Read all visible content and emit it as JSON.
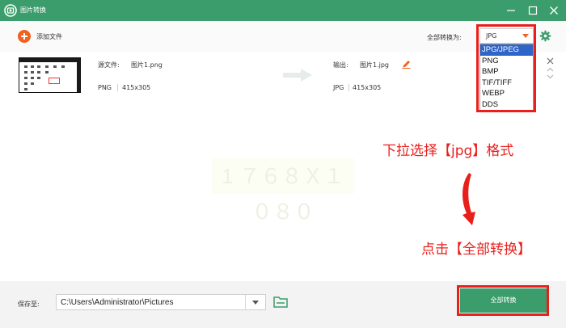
{
  "window": {
    "title": "图片转换"
  },
  "toolbar": {
    "add_label": "添加文件",
    "convert_to_label": "全部转换为:",
    "selected_format": "JPG"
  },
  "dropdown": {
    "options": [
      "JPG/JPEG",
      "PNG",
      "BMP",
      "TIF/TIFF",
      "WEBP",
      "DDS"
    ],
    "selected_index": 0
  },
  "file": {
    "source_label": "源文件:",
    "source_name": "图片1.png",
    "source_format": "PNG",
    "source_dim": "415x305",
    "output_label": "输出:",
    "output_name": "图片1.jpg",
    "output_format": "JPG",
    "output_dim": "415x305"
  },
  "watermark": "1 ７６８Ｘ１０８０",
  "annotations": {
    "select_format": "下拉选择【jpg】格式",
    "click_convert": "点击【全部转换】"
  },
  "bottom": {
    "save_label": "保存至:",
    "path": "C:\\Users\\Administrator\\Pictures",
    "convert_all_label": "全部转换"
  },
  "colors": {
    "brand_green": "#3a9d6b",
    "accent_orange": "#f0621f",
    "annotation_red": "#e8201c",
    "selection_blue": "#2f64c8"
  }
}
